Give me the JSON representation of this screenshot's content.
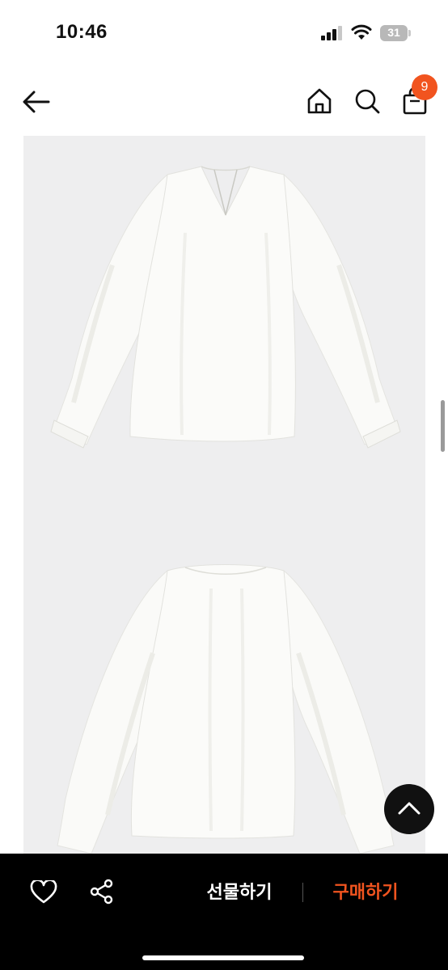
{
  "status_bar": {
    "time": "10:46",
    "battery": "31"
  },
  "header": {
    "back_icon": "arrow-left-icon",
    "home_icon": "home-icon",
    "search_icon": "search-icon",
    "cart_icon": "shopping-bag-icon",
    "cart_count": "9",
    "badge_color": "#f1541f"
  },
  "gallery": {
    "images": [
      {
        "description_icon": "blouse-front-image"
      },
      {
        "description_icon": "blouse-back-image"
      }
    ],
    "background": "#eeeeef"
  },
  "scroll_top": {
    "icon": "chevron-up-icon"
  },
  "bottom_bar": {
    "like_icon": "heart-icon",
    "share_icon": "share-icon",
    "gift_label": "선물하기",
    "buy_label": "구매하기",
    "buy_color": "#f1541f"
  }
}
